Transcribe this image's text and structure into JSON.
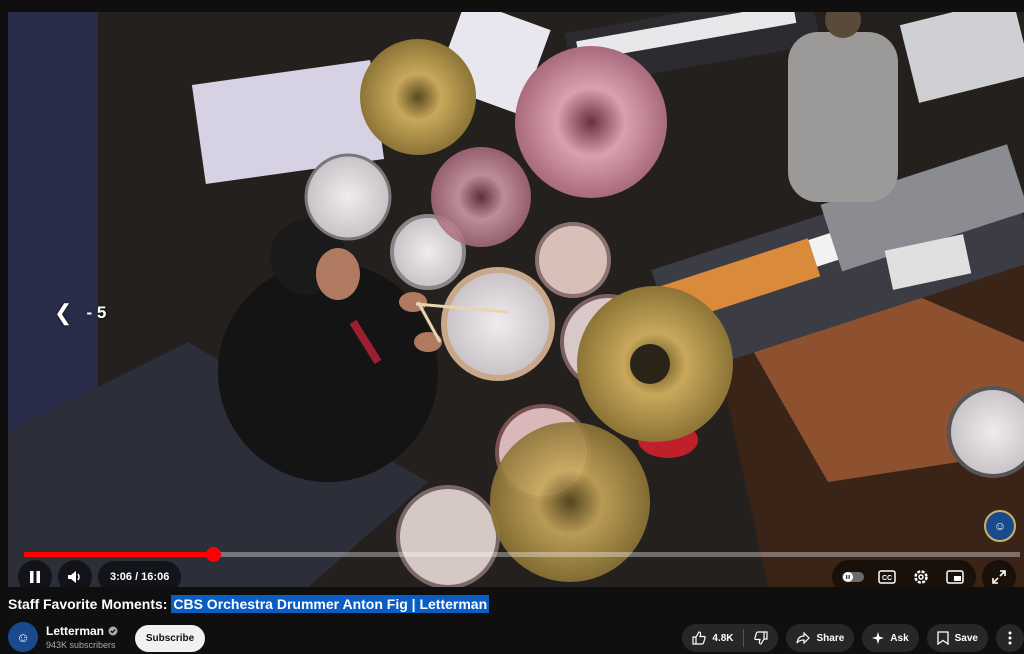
{
  "player": {
    "seek_hint": "- 5",
    "time": "3:06 / 16:06",
    "progress_fraction": 0.19,
    "buffered_fraction": 0.91
  },
  "video": {
    "title_prefix": "Staff Favorite Moments: ",
    "title_highlight": "CBS Orchestra Drummer Anton Fig | Letterman"
  },
  "channel": {
    "name": "Letterman",
    "subscribers": "943K subscribers",
    "subscribe_label": "Subscribe"
  },
  "actions": {
    "likes": "4.8K",
    "share": "Share",
    "ask": "Ask",
    "save": "Save"
  },
  "colors": {
    "accent": "#ff0000",
    "highlight": "#0a5dc2",
    "background": "#0f0f0f"
  },
  "icons": [
    "play-pause-icon",
    "volume-icon",
    "autoplay-toggle-icon",
    "captions-icon",
    "settings-icon",
    "miniplayer-icon",
    "fullscreen-icon",
    "like-icon",
    "dislike-icon",
    "share-icon",
    "ask-icon",
    "save-icon",
    "more-icon",
    "verified-icon"
  ]
}
